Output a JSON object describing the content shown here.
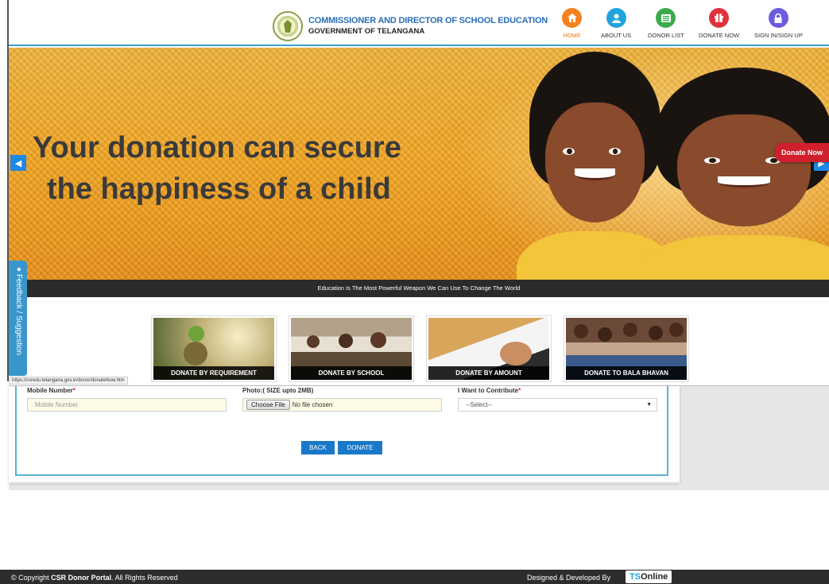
{
  "header": {
    "org_line1": "COMMISSIONER AND DIRECTOR OF SCHOOL EDUCATION",
    "org_line2": "GOVERNMENT OF TELANGANA",
    "nav": [
      {
        "label": "HOME",
        "icon": "home-icon",
        "color": "#f5821f",
        "active": true
      },
      {
        "label": "ABOUT US",
        "icon": "user-icon",
        "color": "#22a3de"
      },
      {
        "label": "DONOR LIST",
        "icon": "list-icon",
        "color": "#3aab4a"
      },
      {
        "label": "DONATE NOW",
        "icon": "gift-icon",
        "color": "#e2313c"
      },
      {
        "label": "SIGN IN/SIGN UP",
        "icon": "lock-icon",
        "color": "#6d5ce0"
      }
    ]
  },
  "banner": {
    "headline_line1": "Your donation can secure",
    "headline_line2": "the happiness of a child",
    "donate_now_tab": "Donate Now",
    "marquee": "Education Is The Most Powerful Weapon We Can Use To Change The World"
  },
  "feedback_tab": "Feedback / Suggestion",
  "tiles": [
    {
      "caption": "DONATE BY REQUIREMENT"
    },
    {
      "caption": "DONATE BY SCHOOL"
    },
    {
      "caption": "DONATE BY AMOUNT"
    },
    {
      "caption": "DONATE TO BALA BHAVAN"
    }
  ],
  "status_url": "https://csredu.telangana.gov.in/donor/donateNow.htm",
  "form": {
    "mobile_label": "Mobile Number",
    "mobile_placeholder": "Mobile Number",
    "photo_label": "Photo:( SIZE upto 2MB)",
    "file_button": "Choose File",
    "file_status": "No file chosen",
    "contribute_label": "I Want to Contribute",
    "contribute_selected": "--Select--",
    "required_mark": "*",
    "back_button": "BACK",
    "donate_button": "DONATE"
  },
  "footer": {
    "copyright_prefix": "© Copyright ",
    "copyright_bold": "CSR Donor Portal",
    "copyright_suffix": ". All Rights Reserved",
    "designed_by": "Designed & Developed By",
    "badge_ts": "TS",
    "badge_online": "Online"
  }
}
